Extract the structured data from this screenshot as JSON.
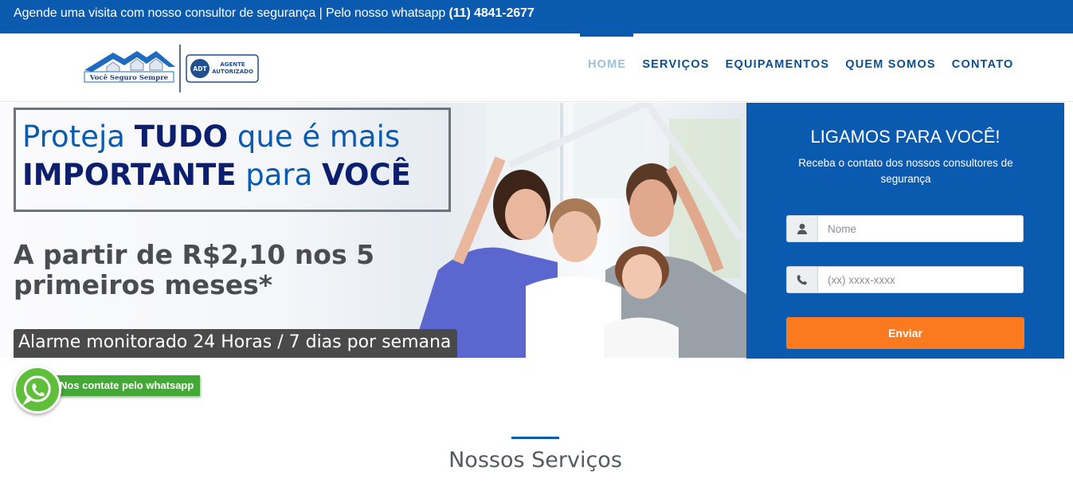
{
  "topbar": {
    "text": "Agende uma visita com nosso consultor de segurança | Pelo nosso whatsapp ",
    "phone": "(11) 4841-2677"
  },
  "brand": {
    "logo_text": "Você Seguro Sempre",
    "badge_mark": "ADT",
    "badge_line1": "AGENTE",
    "badge_line2": "AUTORIZADO"
  },
  "nav": {
    "items": [
      {
        "label": "HOME",
        "active": true
      },
      {
        "label": "SERVIÇOS"
      },
      {
        "label": "EQUIPAMENTOS"
      },
      {
        "label": "QUEM SOMOS"
      },
      {
        "label": "CONTATO"
      }
    ]
  },
  "hero": {
    "headline": {
      "p1": "Proteja ",
      "b1": "TUDO",
      "p2": " que é mais",
      "b2": "IMPORTANTE",
      "p3": " para ",
      "b3": "VOCÊ"
    },
    "price": "A partir de R$2,10 nos 5 primeiros meses*",
    "alarm": "Alarme monitorado 24 Horas / 7 dias por semana"
  },
  "lead_form": {
    "title": "LIGAMOS PARA VOCÊ!",
    "subtitle": "Receba o contato dos nossos consultores de segurança",
    "name_placeholder": "Nome",
    "phone_placeholder": "(xx) xxxx-xxxx",
    "submit_label": "Enviar"
  },
  "whatsapp": {
    "label": "Nos contate pelo whatsapp"
  },
  "services": {
    "title": "Nossos Serviços"
  },
  "colors": {
    "brand_blue": "#0a5bb0",
    "nav_text": "#0c4f8f",
    "nav_active": "#9cc2de",
    "cta_orange": "#fb7a1f",
    "whatsapp_green": "#44a836"
  },
  "icons": [
    "user-icon",
    "phone-icon",
    "whatsapp-icon",
    "house-roof-icon"
  ]
}
